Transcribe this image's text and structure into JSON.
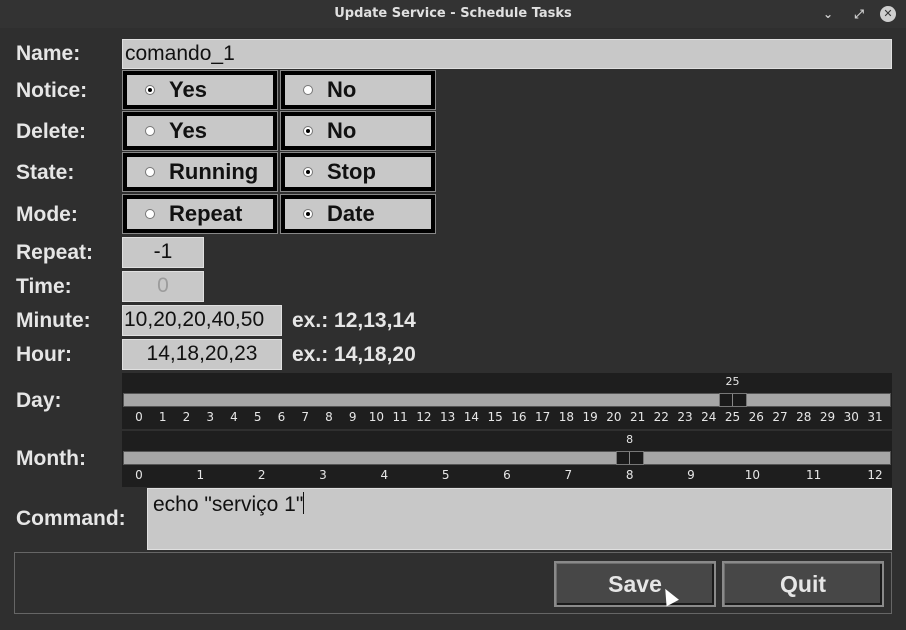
{
  "window": {
    "title": "Update Service - Schedule Tasks",
    "minimize": "⌄",
    "restore": "⤢",
    "close": "✕"
  },
  "labels": {
    "name": "Name:",
    "notice": "Notice:",
    "delete": "Delete:",
    "state": "State:",
    "mode": "Mode:",
    "repeat": "Repeat:",
    "time": "Time:",
    "minute": "Minute:",
    "hour": "Hour:",
    "day": "Day:",
    "month": "Month:",
    "command": "Command:"
  },
  "fields": {
    "name": "comando_1",
    "repeat": "-1",
    "time": "0",
    "minute": "10,20,20,40,50",
    "minute_hint": "ex.: 12,13,14",
    "hour": "14,18,20,23",
    "hour_hint": "ex.: 14,18,20",
    "command": "echo \"serviço 1\""
  },
  "radios": {
    "notice": {
      "options": [
        "Yes",
        "No"
      ],
      "selected": "Yes"
    },
    "delete": {
      "options": [
        "Yes",
        "No"
      ],
      "selected": "No"
    },
    "state": {
      "options": [
        "Running",
        "Stop"
      ],
      "selected": "Stop"
    },
    "mode": {
      "options": [
        "Repeat",
        "Date"
      ],
      "selected": "Date"
    }
  },
  "day_scale": {
    "min": 0,
    "max": 31,
    "value": 25,
    "value_label": "25",
    "ticks": [
      "0",
      "1",
      "2",
      "3",
      "4",
      "5",
      "6",
      "7",
      "8",
      "9",
      "10",
      "11",
      "12",
      "13",
      "14",
      "15",
      "16",
      "17",
      "18",
      "19",
      "20",
      "21",
      "22",
      "23",
      "24",
      "25",
      "26",
      "27",
      "28",
      "29",
      "30",
      "31"
    ]
  },
  "month_scale": {
    "min": 0,
    "max": 12,
    "value": 8,
    "value_label": "8",
    "ticks": [
      "0",
      "1",
      "2",
      "3",
      "4",
      "5",
      "6",
      "7",
      "8",
      "9",
      "10",
      "11",
      "12"
    ]
  },
  "buttons": {
    "save": "Save",
    "quit": "Quit"
  },
  "colors": {
    "background": "#2f2f2f",
    "entry": "#c8c8c8",
    "titlebar": "#333333"
  }
}
